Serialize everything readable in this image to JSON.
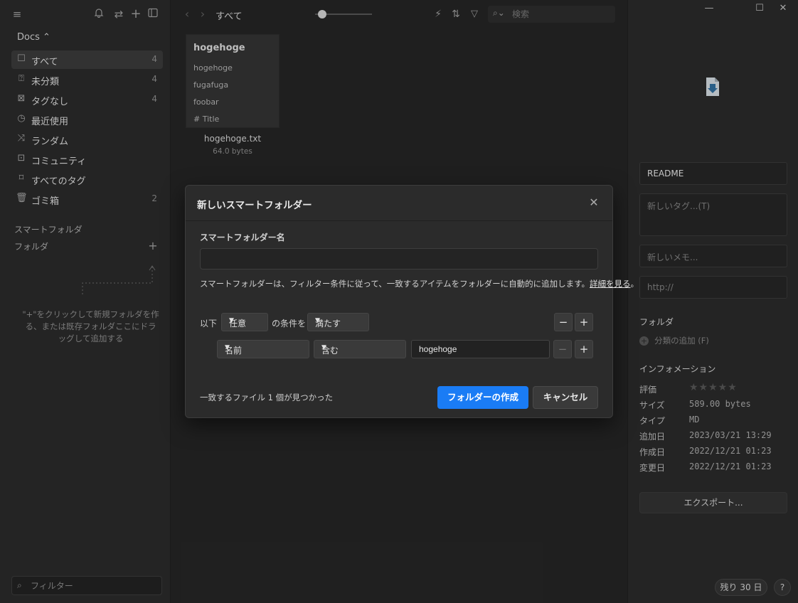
{
  "sidebar": {
    "library_name": "Docs ⌃",
    "items": [
      {
        "label": "すべて",
        "count": "4",
        "icon": "inbox-icon"
      },
      {
        "label": "未分類",
        "count": "4",
        "icon": "unsorted-icon"
      },
      {
        "label": "タグなし",
        "count": "4",
        "icon": "untagged-icon"
      },
      {
        "label": "最近使用",
        "count": "",
        "icon": "clock-icon"
      },
      {
        "label": "ランダム",
        "count": "",
        "icon": "shuffle-icon"
      },
      {
        "label": "コミュニティ",
        "count": "",
        "icon": "community-icon"
      },
      {
        "label": "すべてのタグ",
        "count": "",
        "icon": "bookmark-icon"
      },
      {
        "label": "ゴミ箱",
        "count": "2",
        "icon": "trash-icon"
      }
    ],
    "smart_folders_label": "スマートフォルダ",
    "folders_label": "フォルダ",
    "empty_hint": "\"+\"をクリックして新規フォルダを作る、または既存フォルダここにドラッグして追加する",
    "filter_placeholder": "フィルター"
  },
  "main": {
    "toolbar_title": "すべて",
    "search_placeholder": "検索",
    "card": {
      "title": "hogehoge",
      "lines": [
        "hogehoge",
        "fugafuga",
        "foobar",
        "# Title"
      ],
      "filename": "hogehoge.txt",
      "size": "64.0 bytes"
    }
  },
  "inspector": {
    "name_value": "README",
    "tag_placeholder": "新しいタグ...(T)",
    "memo_placeholder": "新しいメモ...",
    "url_placeholder": "http://",
    "folder_section": "フォルダ",
    "add_category": "分類の追加 (F)",
    "info_section": "インフォメーション",
    "info": [
      {
        "key": "評価",
        "value": ""
      },
      {
        "key": "サイズ",
        "value": "589.00 bytes"
      },
      {
        "key": "タイプ",
        "value": "MD"
      },
      {
        "key": "追加日",
        "value": "2023/03/21 13:29"
      },
      {
        "key": "作成日",
        "value": "2022/12/21 01:23"
      },
      {
        "key": "変更日",
        "value": "2022/12/21 01:23"
      }
    ],
    "export_label": "エクスポート...",
    "trial_label": "残り 30 日",
    "help_label": "?"
  },
  "dialog": {
    "title": "新しいスマートフォルダー",
    "name_label": "スマートフォルダー名",
    "name_value": "",
    "description": "スマートフォルダーは、フィルター条件に従って、一致するアイテムをフォルダーに自動的に追加します。",
    "details_link": "詳細を見る",
    "period": "。",
    "cond_prefix": "以下",
    "cond_match_value": "任意",
    "cond_middle": "の条件を",
    "cond_satisfy_value": "満たす",
    "rule_field_value": "名前",
    "rule_operator_value": "含む",
    "rule_text_value": "hogehoge",
    "status": "一致するファイル 1 個が見つかった",
    "create_button": "フォルダーの作成",
    "cancel_button": "キャンセル"
  },
  "colors": {
    "accent": "#1a7cf5",
    "background": "#242424",
    "sidebar": "#2a2a2a"
  }
}
